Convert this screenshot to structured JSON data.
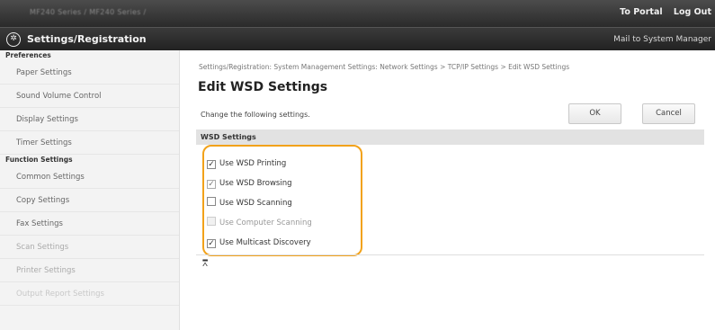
{
  "topbar": {
    "device_name": "MF240 Series / MF240 Series /",
    "to_portal": "To Portal",
    "log_out": "Log Out"
  },
  "header": {
    "title": "Settings/Registration",
    "mail_to": "Mail to System Manager",
    "logo_icon": "settings-registration-icon"
  },
  "sidebar": {
    "groups": [
      {
        "heading": "Preferences",
        "items": [
          "Paper Settings",
          "Sound Volume Control",
          "Display Settings",
          "Timer Settings"
        ]
      },
      {
        "heading": "Function Settings",
        "items": [
          "Common Settings",
          "Copy Settings",
          "Fax Settings",
          "Scan Settings",
          "Printer Settings",
          "Output Report Settings"
        ]
      }
    ]
  },
  "main": {
    "breadcrumb": "Settings/Registration: System Management Settings: Network Settings > TCP/IP Settings > Edit WSD Settings",
    "title": "Edit WSD Settings",
    "instruction": "Change the following settings.",
    "ok_label": "OK",
    "cancel_label": "Cancel",
    "section_title": "WSD Settings",
    "options": [
      {
        "label": "Use WSD Printing",
        "checked": true,
        "enabled": true
      },
      {
        "label": "Use WSD Browsing",
        "checked": true,
        "enabled": false
      },
      {
        "label": "Use WSD Scanning",
        "checked": false,
        "enabled": true
      },
      {
        "label": "Use Computer Scanning",
        "checked": false,
        "enabled": false
      },
      {
        "label": "Use Multicast Discovery",
        "checked": true,
        "enabled": true
      }
    ],
    "highlight_color": "#f2a21a",
    "top_anchor_icon": "back-to-top-icon"
  }
}
